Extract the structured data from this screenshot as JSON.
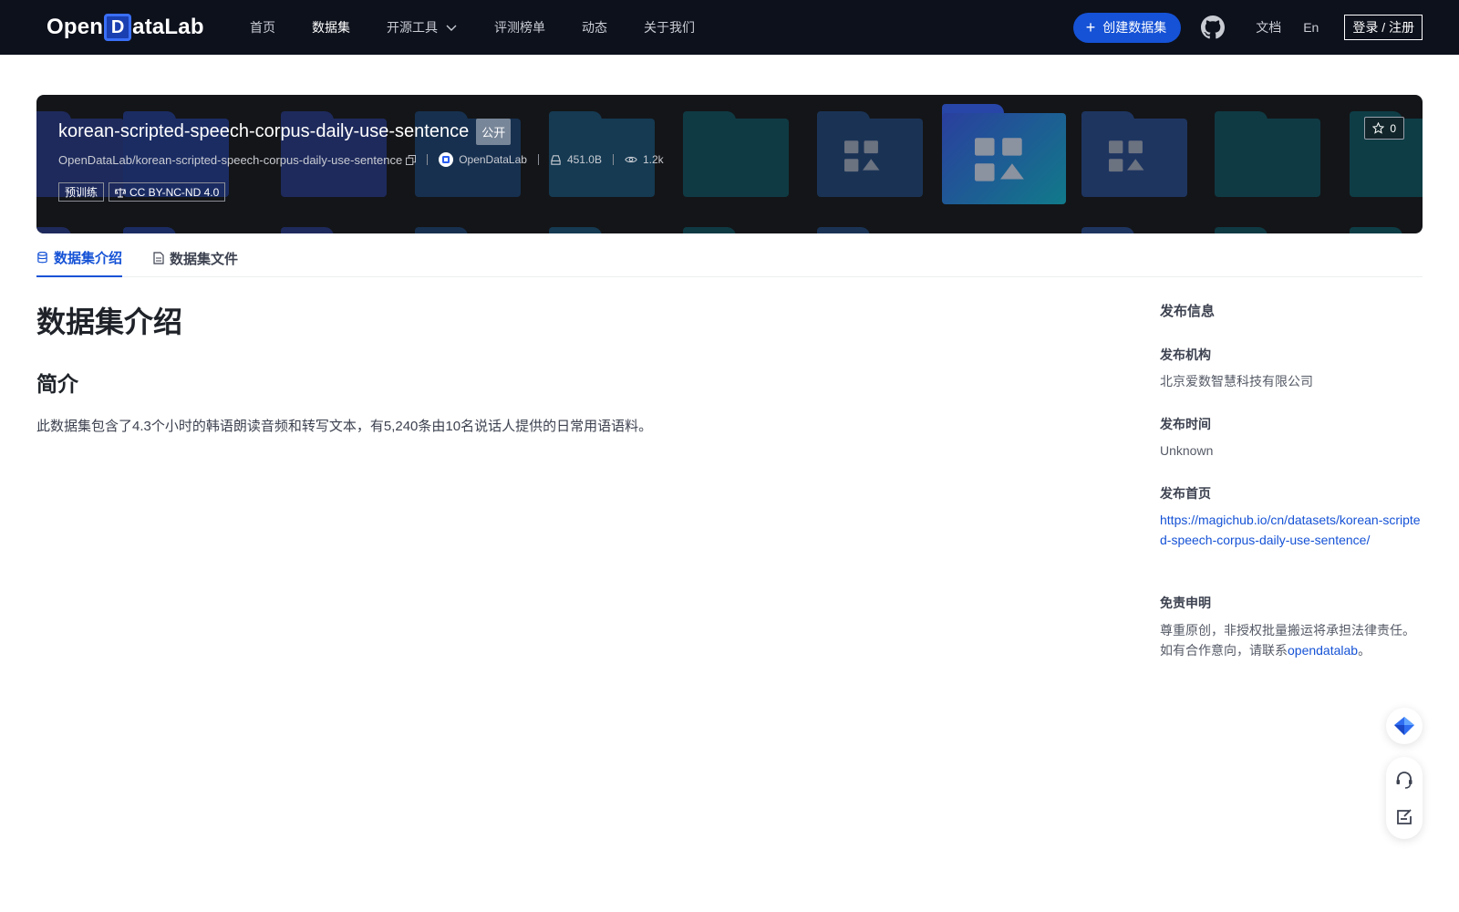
{
  "brand": {
    "logo_pre": "Open",
    "logo_box": "D",
    "logo_post": "ataLab"
  },
  "nav": [
    {
      "label": "首页",
      "active": false
    },
    {
      "label": "数据集",
      "active": true
    },
    {
      "label": "开源工具",
      "active": false,
      "has_dropdown": true
    },
    {
      "label": "评测榜单",
      "active": false
    },
    {
      "label": "动态",
      "active": false
    },
    {
      "label": "关于我们",
      "active": false
    }
  ],
  "header_right": {
    "create_label": "创建数据集",
    "github_icon": "github-icon",
    "docs_label": "文档",
    "lang_label": "En",
    "login_label": "登录 / 注册"
  },
  "dataset": {
    "name": "korean-scripted-speech-corpus-daily-use-sentence",
    "visibility": "公开",
    "path": "OpenDataLab/korean-scripted-speech-corpus-daily-use-sentence",
    "publisher": "OpenDataLab",
    "size": "451.0B",
    "views": "1.2k",
    "tags": [
      "预训练",
      "CC BY-NC-ND 4.0"
    ],
    "stars": "0"
  },
  "tabs": [
    {
      "label": "数据集介绍",
      "active": true
    },
    {
      "label": "数据集文件",
      "active": false
    }
  ],
  "content": {
    "title": "数据集介绍",
    "section_title": "简介",
    "description": "此数据集包含了4.3个小时的韩语朗读音频和转写文本，有5,240条由10名说话人提供的日常用语语料。"
  },
  "sidebar": {
    "heading": "发布信息",
    "org_label": "发布机构",
    "org_value": "北京爱数智慧科技有限公司",
    "time_label": "发布时间",
    "time_value": "Unknown",
    "home_label": "发布首页",
    "home_url": "https://magichub.io/cn/datasets/korean-scripted-speech-corpus-daily-use-sentence/",
    "disclaimer_label": "免责申明",
    "disclaimer_line1": "尊重原创，非授权批量搬运将承担法律责任。",
    "disclaimer_line2_pre": "如有合作意向，请联系",
    "disclaimer_link": "opendatalab",
    "disclaimer_line2_post": "。"
  },
  "colors": {
    "accent": "#1552d6",
    "header_bg": "#0d111c",
    "banner_bg": "#141518"
  }
}
